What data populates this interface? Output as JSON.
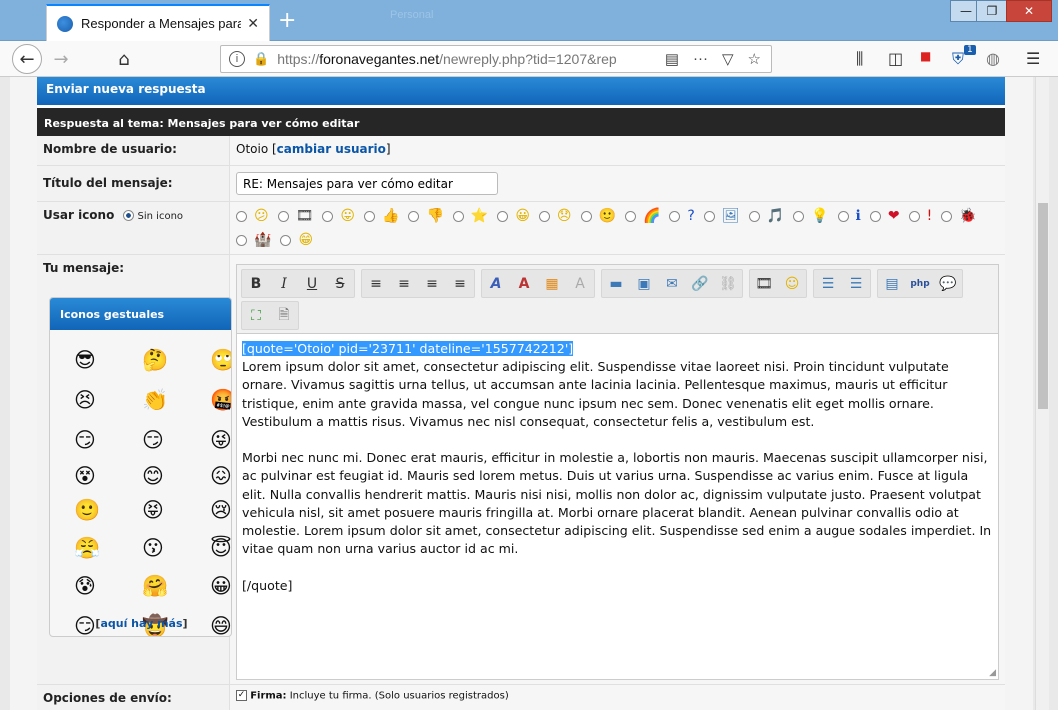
{
  "browser": {
    "tab_title": "Responder a Mensajes para ver cómo editar",
    "tab_close": "✕",
    "new_tab": "+",
    "ghost_tab": "Personal",
    "url_host": "https://",
    "url_domain": "foronavegantes.net",
    "url_path": "/newreply.php?tid=1207&rep",
    "notif_count": "1",
    "win_min": "—",
    "win_max": "❐",
    "win_close": "✕"
  },
  "form": {
    "header": "Enviar nueva respuesta",
    "subheader": "Respuesta al tema: Mensajes para ver cómo editar",
    "username_label": "Nombre de usuario:",
    "username_value": "Otoio [",
    "change_user": "cambiar usuario",
    "username_close": "]",
    "title_label": "Título del mensaje:",
    "title_value": "RE: Mensajes para ver cómo editar",
    "icon_label": "Usar icono",
    "no_icon": "Sin icono",
    "message_label": "Tu mensaje:",
    "options_label": "Opciones de envío:",
    "sig_bold": "Firma:",
    "sig_text": " Incluye tu firma. (Solo usuarios registrados)"
  },
  "post_icons": [
    "😕",
    "🎞",
    "😛",
    "👍",
    "👎",
    "⭐",
    "😀",
    "😞",
    "🙂",
    "🌈",
    "?",
    "🖼",
    "🎵",
    "💡",
    "ℹ",
    "❤",
    "!",
    "🐞",
    "🏰",
    "😁"
  ],
  "post_icon_colors": [
    "#e2b400",
    "#444",
    "#e2b400",
    "#c9922a",
    "#a0522d",
    "#e2b400",
    "#e2b400",
    "#e2b400",
    "#e2b400",
    "#d04",
    "#1a4fc9",
    "#3b79b8",
    "#2a7ed8",
    "#e2b400",
    "#1a4fc9",
    "#d01028",
    "#d01010",
    "#2a7a2a",
    "#555",
    "#e2b400"
  ],
  "editor": {
    "quote_open": "[quote='Otoio' pid='23711' dateline='1557742212']",
    "para1": "Lorem ipsum dolor sit amet, consectetur adipiscing elit. Suspendisse vitae laoreet nisi. Proin tincidunt vulputate ornare. Vivamus sagittis urna tellus, ut accumsan ante lacinia lacinia. Pellentesque maximus, mauris ut efficitur tristique, enim ante gravida massa, vel congue nunc ipsum nec sem. Donec venenatis elit eget mollis ornare. Vestibulum a mattis risus. Vivamus nec nisl consequat, consectetur felis a, vestibulum est.",
    "para2": "Morbi nec nunc mi. Donec erat mauris, efficitur in molestie a, lobortis non mauris. Maecenas suscipit ullamcorper nisi, ac pulvinar est feugiat id. Mauris sed lorem metus. Duis ut varius urna. Suspendisse ac varius enim. Fusce at ligula elit. Nulla convallis hendrerit mattis. Mauris nisi nisi, mollis non dolor ac, dignissim vulputate justo. Praesent volutpat vehicula nisl, sit amet posuere mauris fringilla at. Morbi ornare placerat blandit. Aenean pulvinar convallis odio at molestie. Lorem ipsum dolor sit amet, consectetur adipiscing elit. Suspendisse sed enim a augue sodales imperdiet. In vitae quam non urna varius auctor id ac mi.",
    "quote_close": "[/quote]"
  },
  "toolbar": {
    "bold": "B",
    "italic": "I",
    "underline": "U",
    "strike": "S",
    "align_left": "≡",
    "align_center": "≡",
    "align_right": "≡",
    "justify": "≡",
    "font": "A",
    "size": "A",
    "color": "▦",
    "clear": "A",
    "hr": "▬",
    "image": "▣",
    "email": "✉",
    "link": "🔗",
    "unlink": "⛓",
    "video": "🎞",
    "emoticon": "☺",
    "bullets": "☰",
    "numbers": "☰",
    "code": "▤",
    "php": "php",
    "quote": "💬",
    "maximize": "⛶",
    "source": "🗎"
  },
  "smilies": {
    "header": "Iconos gestuales",
    "items": [
      "😎",
      "🤔",
      "🙄",
      "😣",
      "👏",
      "🤬",
      "😏",
      "😏",
      "😜",
      "😵",
      "😊",
      "😖",
      "🙂",
      "😝",
      "😢",
      "😤",
      "😗",
      "😇",
      "😰",
      "🤗",
      "😀",
      "😏",
      "🤠",
      "😄"
    ],
    "more_open": "[",
    "more_link": "aquí hay más",
    "more_close": "]"
  }
}
